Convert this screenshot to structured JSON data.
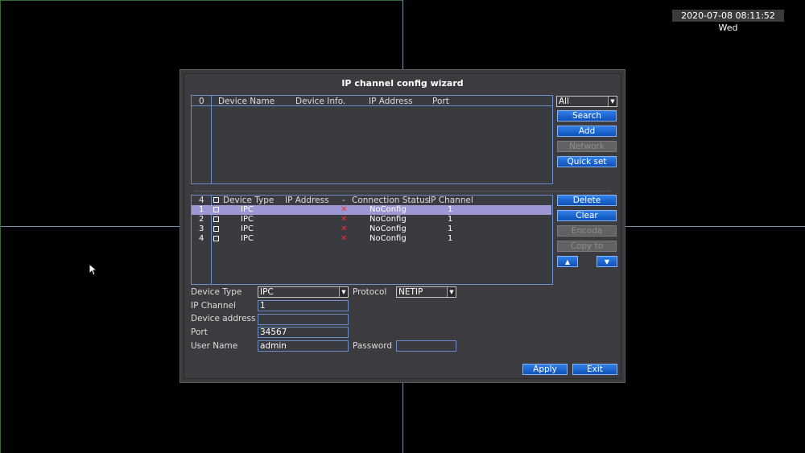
{
  "clock": "2020-07-08 08:11:52 Wed",
  "dialog": {
    "title": "IP channel config wizard",
    "search_table": {
      "count": "0",
      "headers": [
        "Device Name",
        "Device Info.",
        "IP Address",
        "Port"
      ]
    },
    "filter": {
      "value": "All"
    },
    "search_buttons": [
      "Search",
      "Add",
      "Network",
      "Quick set"
    ],
    "added_table": {
      "count": "4",
      "headers": [
        "Device Type",
        "IP Address",
        "-",
        "Connection Status",
        "IP Channel"
      ],
      "rows": [
        {
          "num": "1",
          "type": "IPC",
          "ip": "",
          "status": "NoConfig",
          "channel": "1"
        },
        {
          "num": "2",
          "type": "IPC",
          "ip": "",
          "status": "NoConfig",
          "channel": "1"
        },
        {
          "num": "3",
          "type": "IPC",
          "ip": "",
          "status": "NoConfig",
          "channel": "1"
        },
        {
          "num": "4",
          "type": "IPC",
          "ip": "",
          "status": "NoConfig",
          "channel": "1"
        }
      ]
    },
    "added_buttons": [
      "Delete",
      "Clear",
      "Encoda",
      "Copy to"
    ],
    "arrows": {
      "up": "▲",
      "down": "▼"
    },
    "form": {
      "device_type_label": "Device Type",
      "device_type_value": "IPC",
      "protocol_label": "Protocol",
      "protocol_value": "NETIP",
      "ip_channel_label": "IP Channel",
      "ip_channel_value": "1",
      "device_address_label": "Device address",
      "device_address_value": "",
      "port_label": "Port",
      "port_value": "34567",
      "username_label": "User Name",
      "username_value": "admin",
      "password_label": "Password",
      "password_value": ""
    },
    "apply_label": "Apply",
    "exit_label": "Exit"
  }
}
